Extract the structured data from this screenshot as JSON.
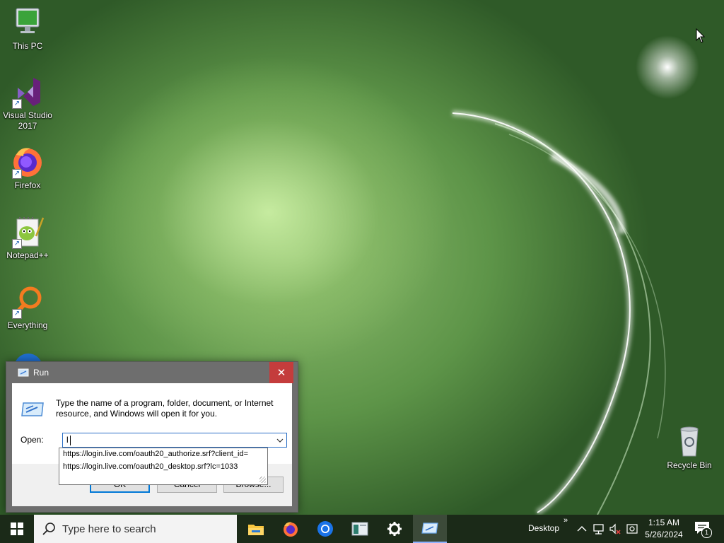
{
  "desktop": {
    "icons": [
      {
        "label_line1": "This PC",
        "label_line2": ""
      },
      {
        "label_line1": "Visual Studio",
        "label_line2": "2017"
      },
      {
        "label_line1": "Firefox",
        "label_line2": ""
      },
      {
        "label_line1": "Notepad++",
        "label_line2": ""
      },
      {
        "label_line1": "Everything",
        "label_line2": ""
      },
      {
        "label_line1": "Recycle Bin",
        "label_line2": ""
      }
    ]
  },
  "run_dialog": {
    "title": "Run",
    "close_glyph": "✕",
    "description": "Type the name of a program, folder, document, or Internet resource, and Windows will open it for you.",
    "open_label": "Open:",
    "input_value": "l",
    "buttons": {
      "ok": "OK",
      "cancel": "Cancel",
      "browse": "Browse..."
    },
    "autocomplete": [
      "https://login.live.com/oauth20_authorize.srf?client_id=",
      "https://login.live.com/oauth20_desktop.srf?lc=1033"
    ]
  },
  "taskbar": {
    "search_placeholder": "Type here to search",
    "desktop_label": "Desktop",
    "chevron": "»",
    "time": "1:15 AM",
    "date": "5/26/2024",
    "notification_count": "1"
  },
  "colors": {
    "taskbar_bg": "#1b2a18",
    "close_red": "#c43c3c",
    "accent": "#0078d7"
  }
}
